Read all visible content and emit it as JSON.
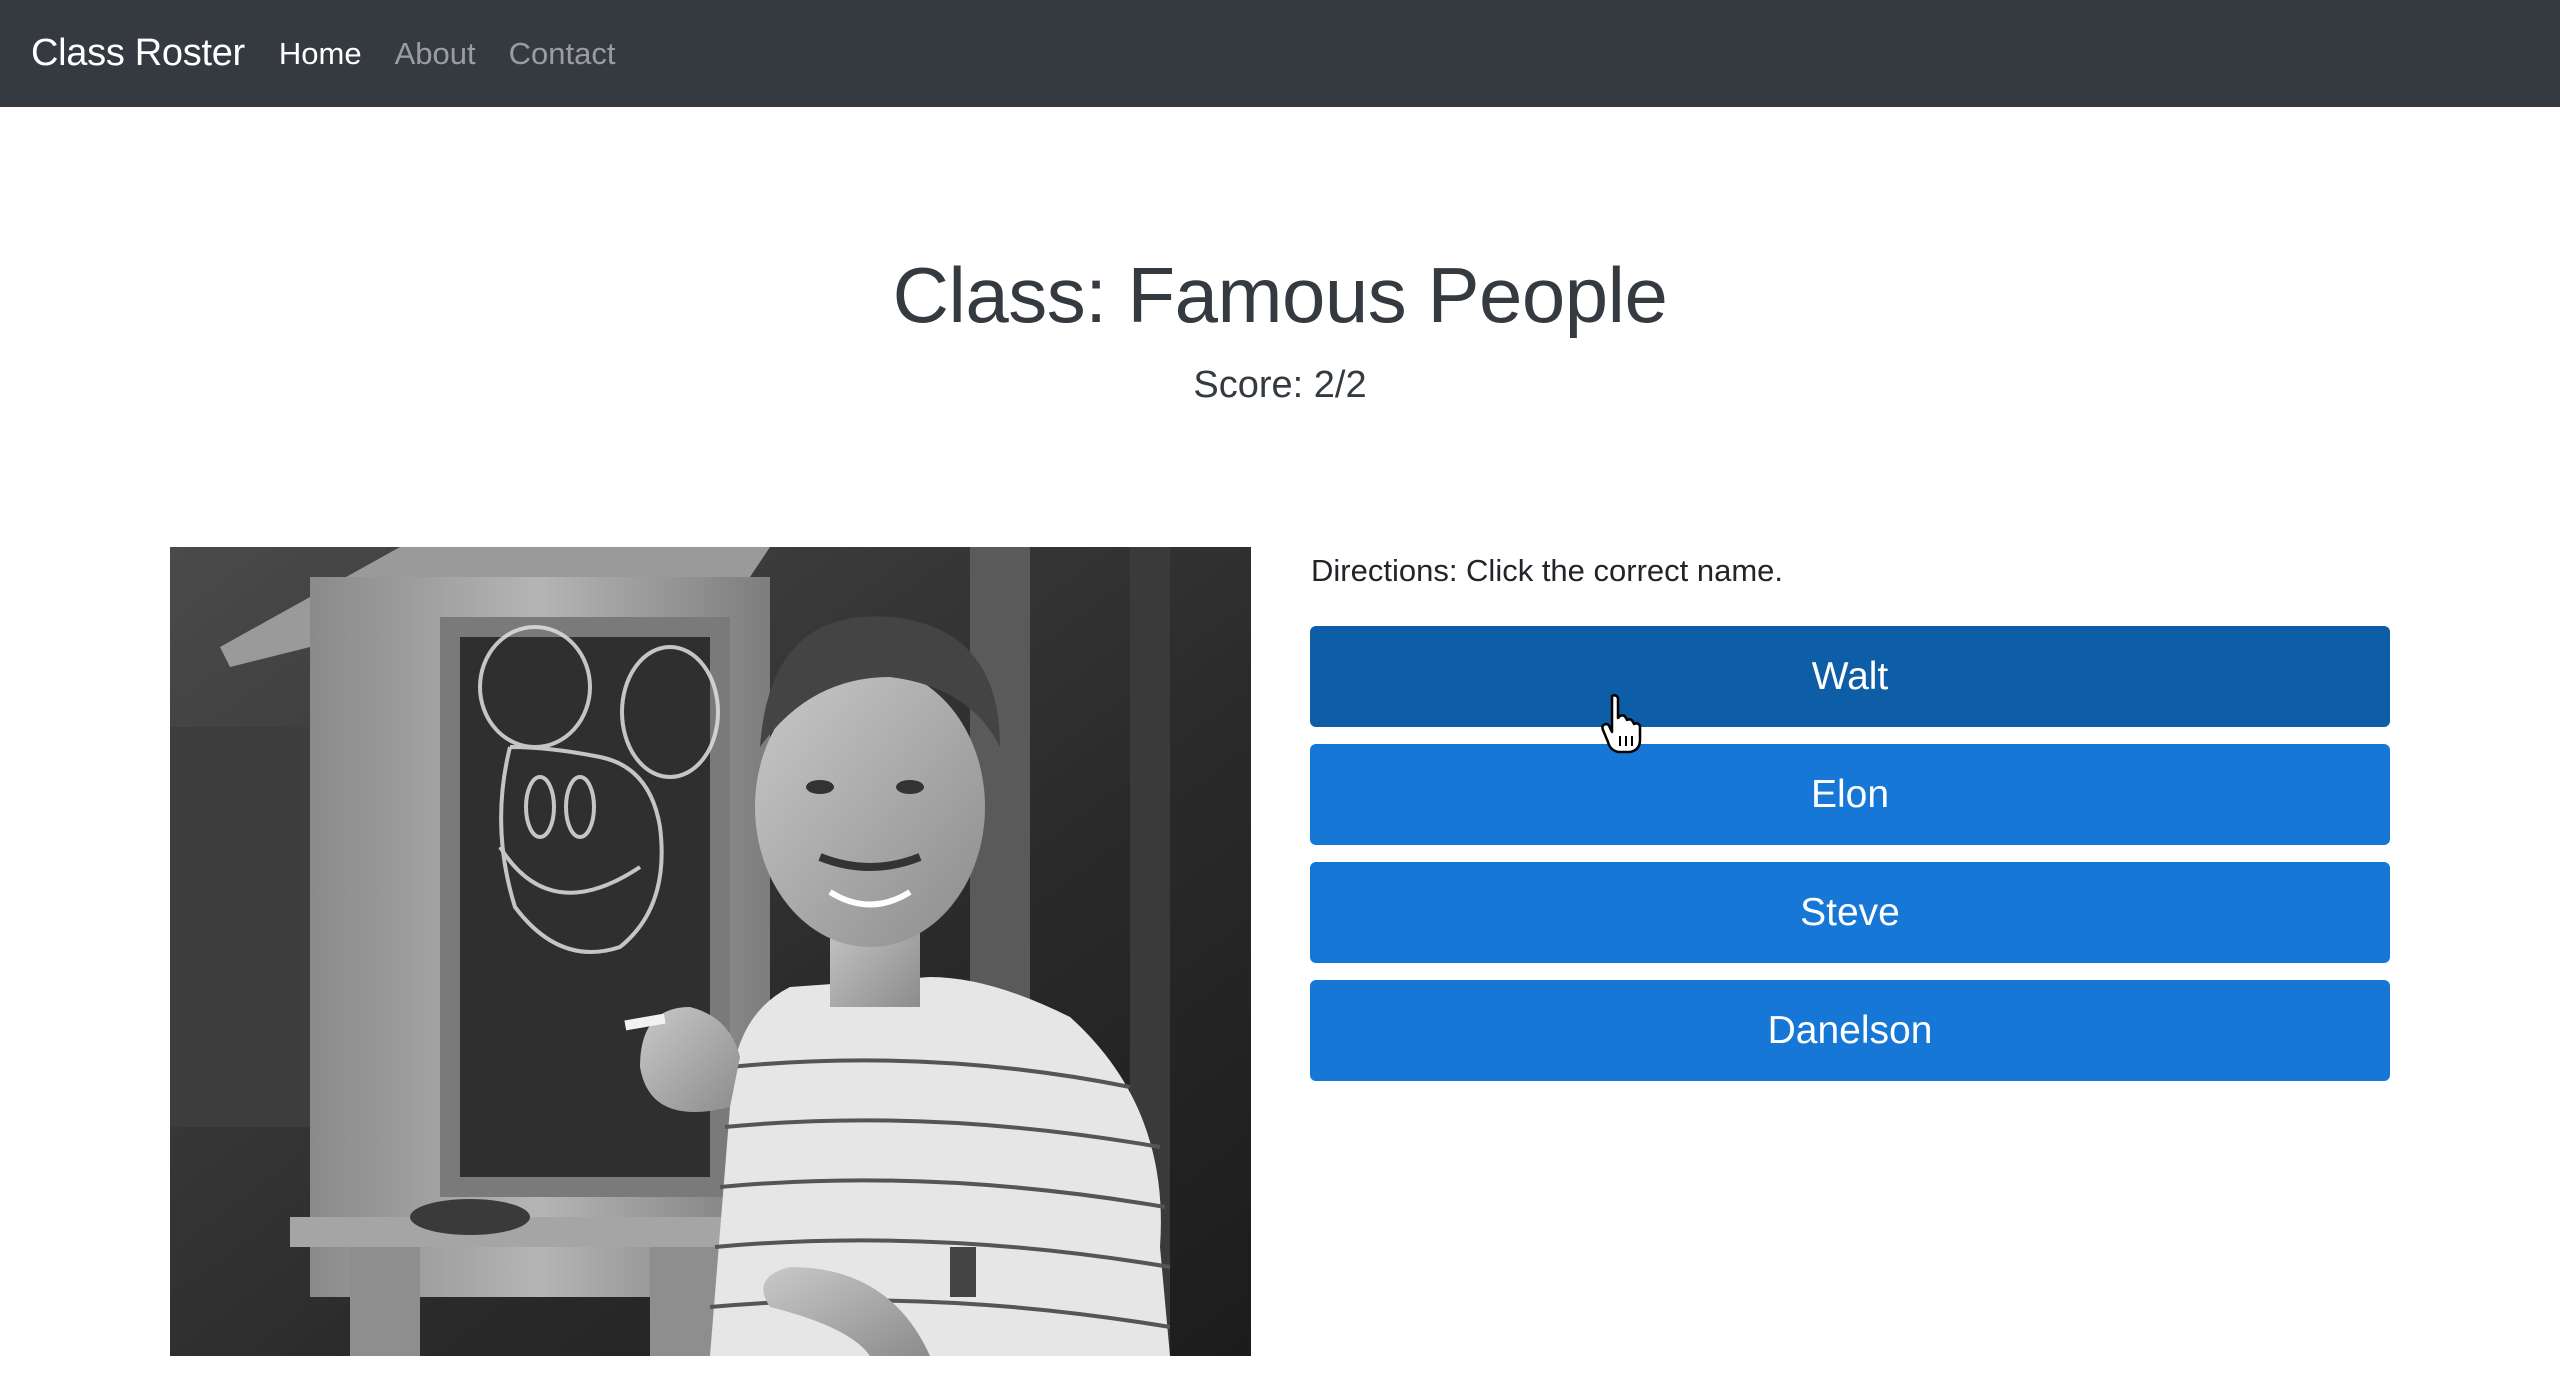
{
  "nav": {
    "brand": "Class Roster",
    "links": [
      {
        "label": "Home",
        "active": true
      },
      {
        "label": "About",
        "active": false
      },
      {
        "label": "Contact",
        "active": false
      }
    ]
  },
  "main": {
    "title": "Class: Famous People",
    "score": "Score: 2/2",
    "directions": "Directions: Click the correct name.",
    "choices": [
      {
        "label": "Walt",
        "state": "hover"
      },
      {
        "label": "Elon",
        "state": "default"
      },
      {
        "label": "Steve",
        "state": "default"
      },
      {
        "label": "Danelson",
        "state": "default"
      }
    ]
  },
  "colors": {
    "navbar": "#343a40",
    "button": "#1677d6",
    "button_hover": "#0d5ea7"
  }
}
